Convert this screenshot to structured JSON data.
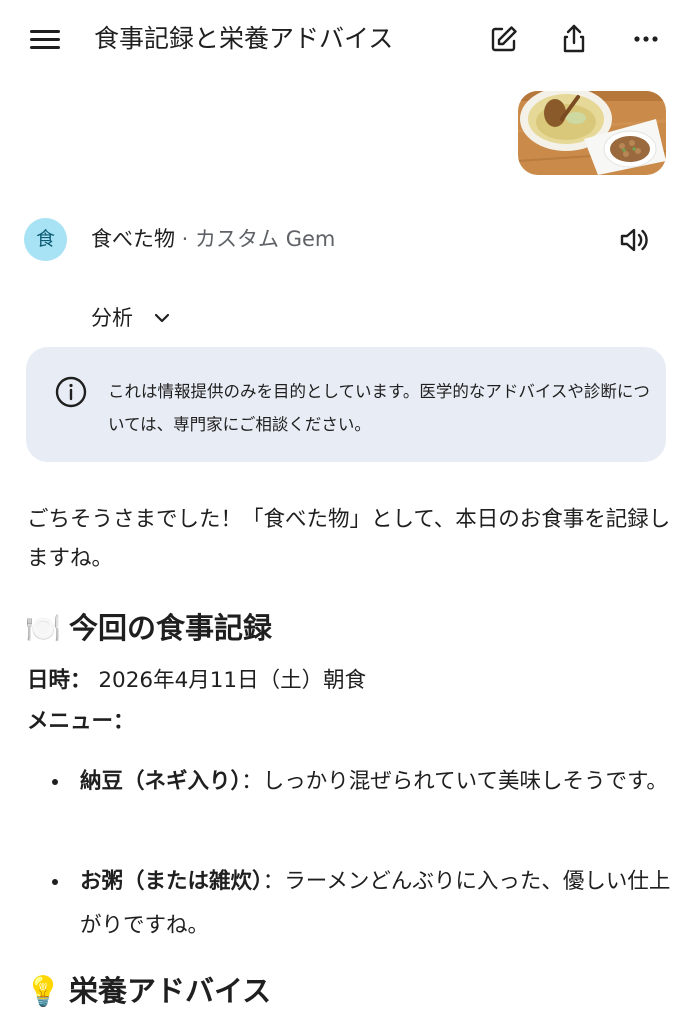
{
  "header": {
    "title": "食事記録と栄養アドバイス",
    "menu_icon": "menu-icon",
    "edit_icon": "edit-icon",
    "share_icon": "share-icon",
    "more_icon": "more-icon"
  },
  "attachment": {
    "icon": "food-photo-thumbnail"
  },
  "gem": {
    "avatar_letter": "食",
    "name": "食べた物",
    "separator": " · ",
    "type": "カスタム Gem",
    "speaker_icon": "speaker-icon",
    "avatar_color": "#a8e2f5"
  },
  "analysis": {
    "label": "分析",
    "icon": "chevron-down-icon"
  },
  "notice": {
    "text": "これは情報提供のみを目的としています。医学的なアドバイスや診断については、専門家にご相談ください。",
    "icon": "info-icon",
    "background": "#e8edf5"
  },
  "response": {
    "intro": "ごちそうさまでした！「食べた物」として、本日のお食事を記録しますね。",
    "record_heading": "今回の食事記録",
    "record_emoji": "🍽️",
    "date_label": "日時：",
    "date_value": " 2026年4月11日（土）朝食",
    "menu_label": "メニュー：",
    "items": [
      {
        "name": "納豆（ネギ入り）",
        "desc": "：しっかり混ぜられていて美味しそうです。"
      },
      {
        "name": "お粥（または雑炊）",
        "desc": "：ラーメンどんぶりに入った、優しい仕上がりですね。"
      }
    ],
    "advice_heading": "栄養アドバイス",
    "advice_emoji": "💡"
  }
}
